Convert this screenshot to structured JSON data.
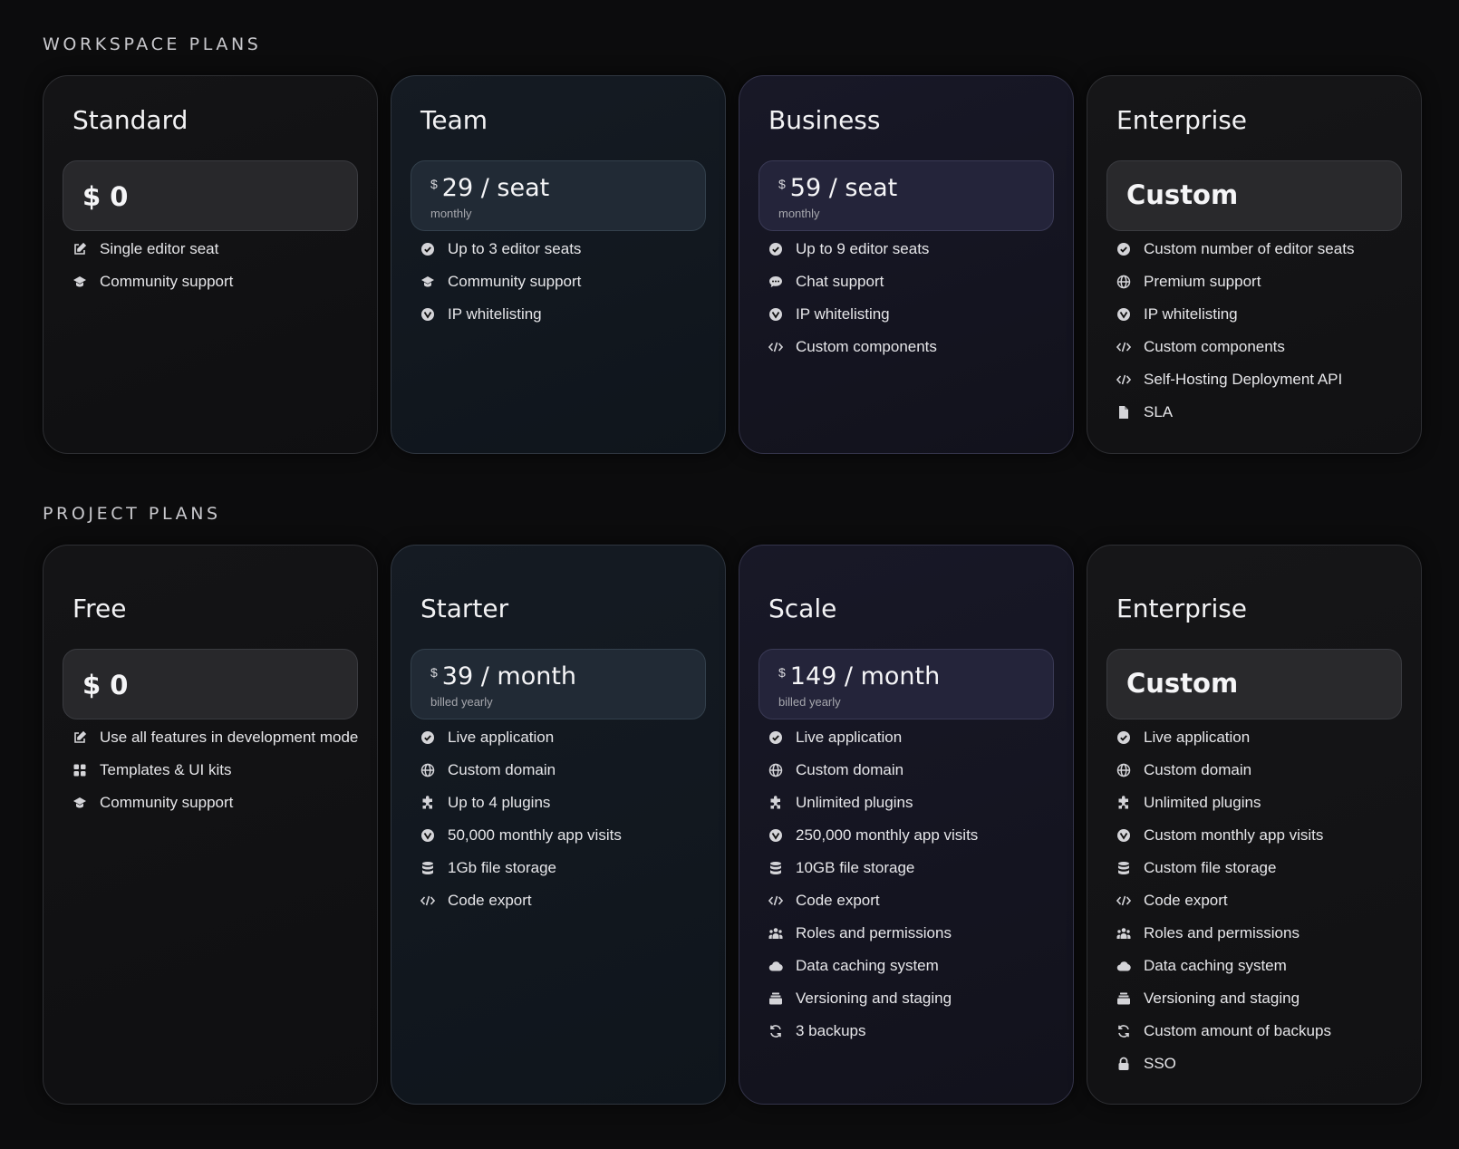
{
  "workspace": {
    "title": "WORKSPACE PLANS",
    "plans": [
      {
        "name": "Standard",
        "price": "$ 0",
        "features": [
          {
            "icon": "edit-icon",
            "text": "Single editor seat"
          },
          {
            "icon": "graduation-cap-icon",
            "text": "Community support"
          }
        ]
      },
      {
        "name": "Team",
        "currency": "$",
        "amount": "29 / seat",
        "period": "monthly",
        "features": [
          {
            "icon": "check-circle-icon",
            "text": "Up to 3 editor seats"
          },
          {
            "icon": "graduation-cap-icon",
            "text": "Community support"
          },
          {
            "icon": "shield-icon",
            "text": "IP whitelisting"
          }
        ]
      },
      {
        "name": "Business",
        "currency": "$",
        "amount": "59 / seat",
        "period": "monthly",
        "features": [
          {
            "icon": "check-circle-icon",
            "text": "Up to 9 editor seats"
          },
          {
            "icon": "chat-icon",
            "text": "Chat support"
          },
          {
            "icon": "shield-icon",
            "text": "IP whitelisting"
          },
          {
            "icon": "code-icon",
            "text": "Custom components"
          }
        ]
      },
      {
        "name": "Enterprise",
        "price": "Custom",
        "features": [
          {
            "icon": "check-circle-icon",
            "text": "Custom number of editor seats"
          },
          {
            "icon": "globe-icon",
            "text": "Premium support"
          },
          {
            "icon": "shield-icon",
            "text": "IP whitelisting"
          },
          {
            "icon": "code-icon",
            "text": "Custom components"
          },
          {
            "icon": "code-icon",
            "text": "Self-Hosting Deployment API"
          },
          {
            "icon": "document-icon",
            "text": "SLA"
          }
        ]
      }
    ]
  },
  "project": {
    "title": "PROJECT PLANS",
    "plans": [
      {
        "name": "Free",
        "price": "$ 0",
        "features": [
          {
            "icon": "edit-icon",
            "text": "Use all features in development mode"
          },
          {
            "icon": "grid-icon",
            "text": "Templates & UI kits"
          },
          {
            "icon": "graduation-cap-icon",
            "text": "Community support"
          }
        ]
      },
      {
        "name": "Starter",
        "currency": "$",
        "amount": "39 / month",
        "period": "billed yearly",
        "features": [
          {
            "icon": "check-circle-icon",
            "text": "Live application"
          },
          {
            "icon": "globe-icon",
            "text": "Custom domain"
          },
          {
            "icon": "puzzle-icon",
            "text": "Up to 4 plugins"
          },
          {
            "icon": "shield-icon",
            "text": "50,000 monthly app visits"
          },
          {
            "icon": "database-icon",
            "text": "1Gb file storage"
          },
          {
            "icon": "code-icon",
            "text": "Code export"
          }
        ]
      },
      {
        "name": "Scale",
        "currency": "$",
        "amount": "149 / month",
        "period": "billed yearly",
        "features": [
          {
            "icon": "check-circle-icon",
            "text": "Live application"
          },
          {
            "icon": "globe-icon",
            "text": "Custom domain"
          },
          {
            "icon": "puzzle-icon",
            "text": "Unlimited plugins"
          },
          {
            "icon": "shield-icon",
            "text": "250,000 monthly app visits"
          },
          {
            "icon": "database-icon",
            "text": "10GB file storage"
          },
          {
            "icon": "code-icon",
            "text": "Code export"
          },
          {
            "icon": "users-icon",
            "text": "Roles and permissions"
          },
          {
            "icon": "cloud-icon",
            "text": "Data caching system"
          },
          {
            "icon": "layers-icon",
            "text": "Versioning and staging"
          },
          {
            "icon": "refresh-icon",
            "text": "3 backups"
          }
        ]
      },
      {
        "name": "Enterprise",
        "price": "Custom",
        "features": [
          {
            "icon": "check-circle-icon",
            "text": "Live application"
          },
          {
            "icon": "globe-icon",
            "text": "Custom domain"
          },
          {
            "icon": "puzzle-icon",
            "text": "Unlimited plugins"
          },
          {
            "icon": "shield-icon",
            "text": "Custom monthly app visits"
          },
          {
            "icon": "database-icon",
            "text": "Custom file storage"
          },
          {
            "icon": "code-icon",
            "text": "Code export"
          },
          {
            "icon": "users-icon",
            "text": "Roles and permissions"
          },
          {
            "icon": "cloud-icon",
            "text": "Data caching system"
          },
          {
            "icon": "layers-icon",
            "text": "Versioning and staging"
          },
          {
            "icon": "refresh-icon",
            "text": "Custom amount of backups"
          },
          {
            "icon": "lock-icon",
            "text": "SSO"
          }
        ]
      }
    ]
  }
}
